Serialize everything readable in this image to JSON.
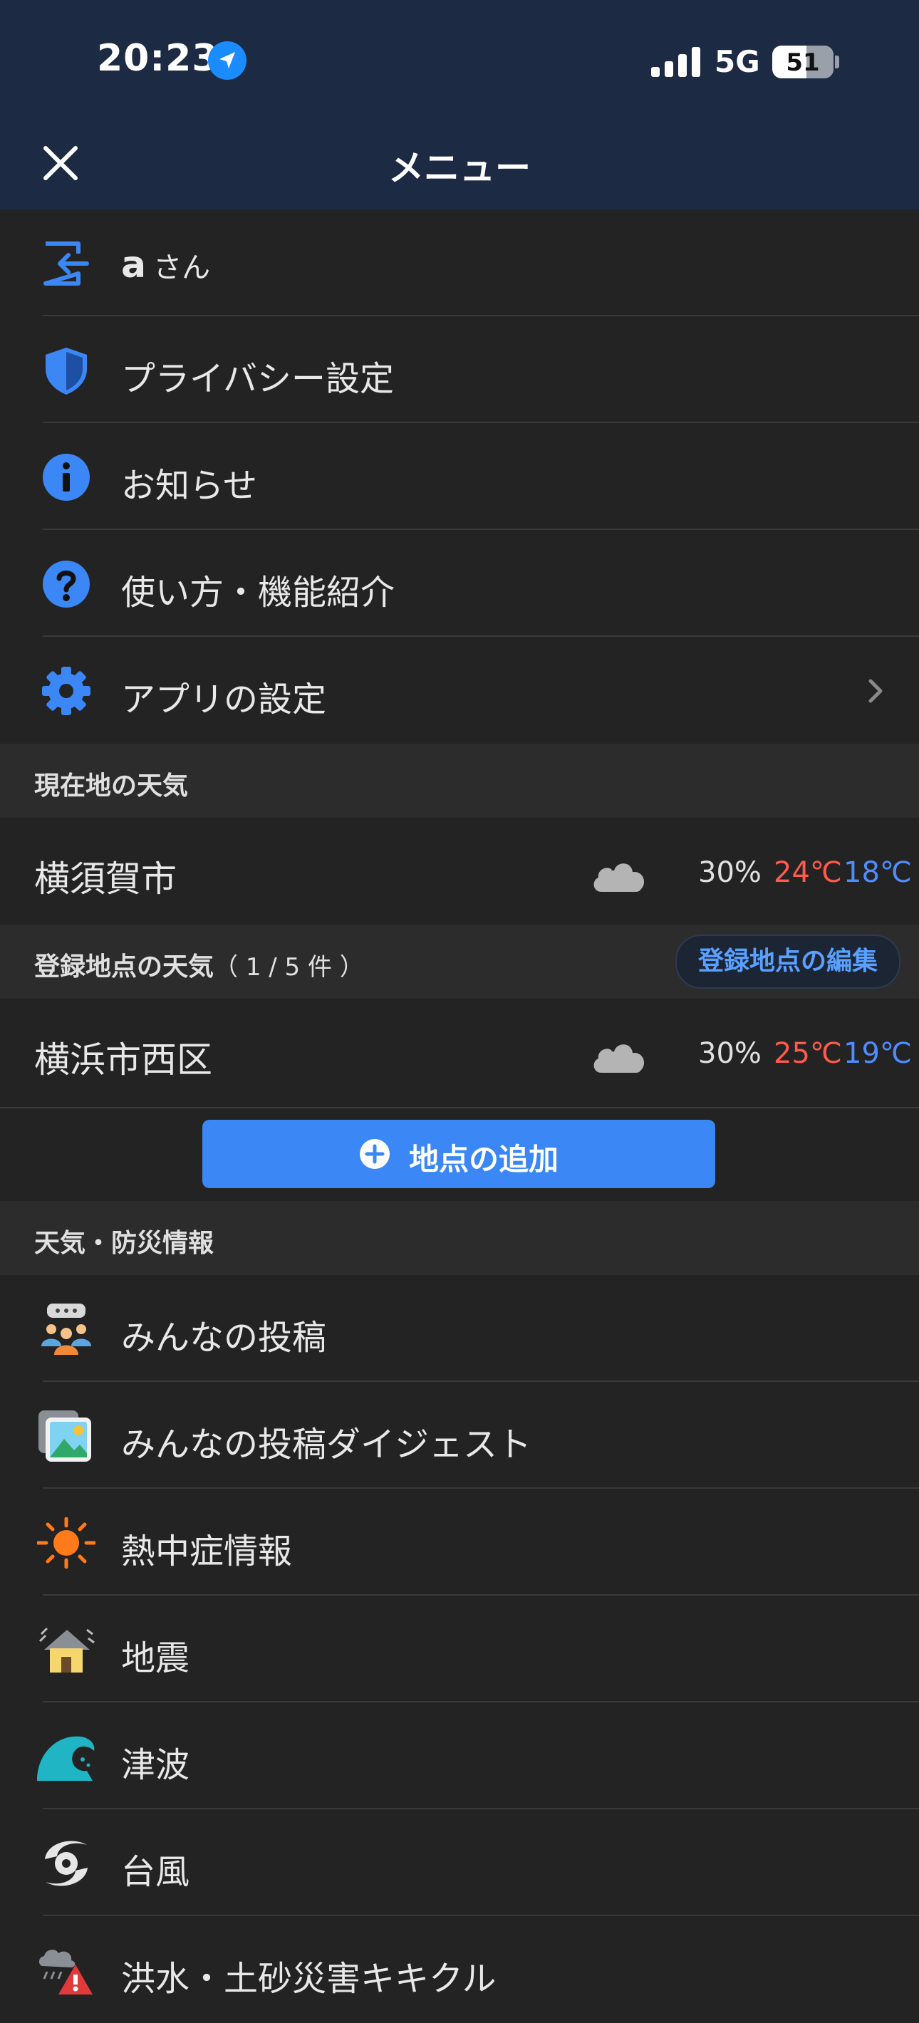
{
  "status_bar": {
    "time": "20:23",
    "network": "5G",
    "battery": "51"
  },
  "header": {
    "title": "メニュー"
  },
  "account": {
    "name": "a",
    "suffix": "さん"
  },
  "menu_items": [
    {
      "label": "プライバシー設定"
    },
    {
      "label": "お知らせ"
    },
    {
      "label": "使い方・機能紹介"
    },
    {
      "label": "アプリの設定"
    }
  ],
  "current_weather": {
    "header": "現在地の天気",
    "city": "横須賀市",
    "precip": "30%",
    "high": "24℃",
    "low": "18℃"
  },
  "registered_weather": {
    "header": "登録地点の天気",
    "count": "（ 1 / 5 件 ）",
    "edit_label": "登録地点の編集",
    "locations": [
      {
        "city": "横浜市西区",
        "precip": "30%",
        "high": "25℃",
        "low": "19℃"
      }
    ],
    "add_label": "地点の追加"
  },
  "disaster": {
    "header": "天気・防災情報",
    "items": [
      {
        "label": "みんなの投稿"
      },
      {
        "label": "みんなの投稿ダイジェスト"
      },
      {
        "label": "熱中症情報"
      },
      {
        "label": "地震"
      },
      {
        "label": "津波"
      },
      {
        "label": "台風"
      },
      {
        "label": "洪水・土砂災害キキクル"
      }
    ]
  },
  "colors": {
    "accent": "#3b87f5",
    "high_temp": "#ff5a4e",
    "low_temp": "#4f8dff",
    "nav_bg": "#1c2a44"
  }
}
